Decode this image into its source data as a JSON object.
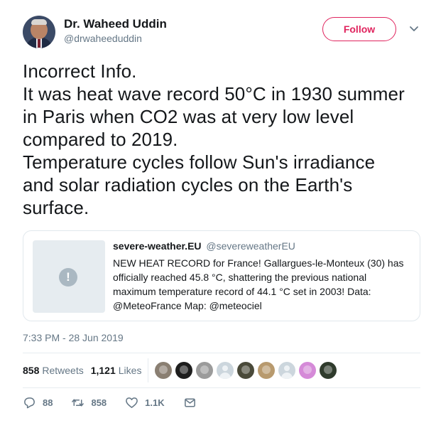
{
  "author": {
    "name": "Dr. Waheed Uddin",
    "handle": "@drwaheeduddin",
    "follow_label": "Follow"
  },
  "tweet": {
    "text": "Incorrect Info.\nIt was heat wave record 50°C in 1930 summer\nin Paris when CO2 was at very low level\ncompared to 2019.\nTemperature cycles follow Sun's irradiance\nand solar radiation cycles on the Earth's\nsurface.",
    "timestamp": "7:33 PM - 28 Jun 2019"
  },
  "quoted": {
    "name": "severe-weather.EU",
    "handle": "@severeweatherEU",
    "text": "NEW HEAT RECORD for France! Gallargues-le-Monteux (30) has officially reached 45.8 °C, shattering the previous national maximum temperature record of 44.1 °C set in 2003! Data: @MeteoFrance Map: @meteociel",
    "media_icon": "!"
  },
  "stats": {
    "retweets_count": "858",
    "retweets_label": "Retweets",
    "likes_count": "1,121",
    "likes_label": "Likes"
  },
  "likers": [
    {
      "name": "liker-1",
      "color": "#8a7f72"
    },
    {
      "name": "liker-2",
      "color": "#1e1e1e"
    },
    {
      "name": "liker-3",
      "color": "#9b9b9b"
    },
    {
      "name": "liker-4",
      "color": "default"
    },
    {
      "name": "liker-5",
      "color": "#4a4a3a"
    },
    {
      "name": "liker-6",
      "color": "#b89a6e"
    },
    {
      "name": "liker-7",
      "color": "default"
    },
    {
      "name": "liker-8",
      "color": "#d58ad8"
    },
    {
      "name": "liker-9",
      "color": "#2f3b2c"
    }
  ],
  "actions": {
    "reply_count": "88",
    "retweet_count": "858",
    "like_count": "1.1K"
  },
  "colors": {
    "follow_accent": "#e0245e",
    "muted_text": "#657786",
    "border": "#e1e8ed"
  }
}
